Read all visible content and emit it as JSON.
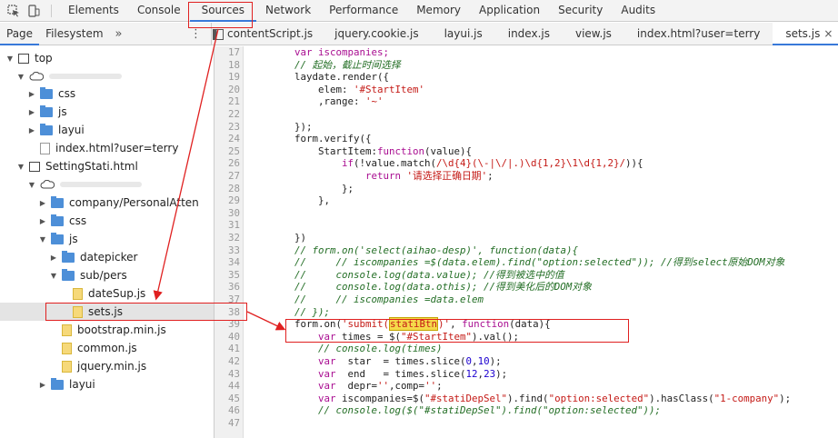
{
  "toolbar": {
    "tabs": [
      {
        "label": "Elements"
      },
      {
        "label": "Console"
      },
      {
        "label": "Sources"
      },
      {
        "label": "Network"
      },
      {
        "label": "Performance"
      },
      {
        "label": "Memory"
      },
      {
        "label": "Application"
      },
      {
        "label": "Security"
      },
      {
        "label": "Audits"
      }
    ],
    "active": "Sources"
  },
  "navigator": {
    "tabs": [
      {
        "label": "Page"
      },
      {
        "label": "Filesystem"
      }
    ],
    "more": "»",
    "menu": "⋮"
  },
  "editor_tabs": [
    {
      "label": "contentScript.js"
    },
    {
      "label": "jquery.cookie.js"
    },
    {
      "label": "layui.js"
    },
    {
      "label": "index.js"
    },
    {
      "label": "view.js"
    },
    {
      "label": "index.html?user=terry"
    },
    {
      "label": "sets.js",
      "close": "×"
    }
  ],
  "tree": [
    {
      "label": "top",
      "type": "frame",
      "expanded": true
    },
    {
      "label": "",
      "type": "domain",
      "expanded": true
    },
    {
      "label": "css",
      "type": "folder",
      "expanded": false
    },
    {
      "label": "js",
      "type": "folder",
      "expanded": false
    },
    {
      "label": "layui",
      "type": "folder",
      "expanded": false
    },
    {
      "label": "index.html?user=terry",
      "type": "file"
    },
    {
      "label": "SettingStati.html",
      "type": "frame",
      "expanded": true
    },
    {
      "label": "",
      "type": "domain",
      "expanded": true
    },
    {
      "label": "company/PersonalAtten",
      "type": "folder",
      "expanded": false
    },
    {
      "label": "css",
      "type": "folder",
      "expanded": false
    },
    {
      "label": "js",
      "type": "folder",
      "expanded": true
    },
    {
      "label": "datepicker",
      "type": "folder",
      "expanded": false
    },
    {
      "label": "sub/pers",
      "type": "folder",
      "expanded": true
    },
    {
      "label": "dateSup.js",
      "type": "jsfile"
    },
    {
      "label": "sets.js",
      "type": "jsfile",
      "selected": true
    },
    {
      "label": "bootstrap.min.js",
      "type": "jsfile"
    },
    {
      "label": "common.js",
      "type": "jsfile"
    },
    {
      "label": "jquery.min.js",
      "type": "jsfile"
    },
    {
      "label": "layui",
      "type": "folder",
      "expanded": false
    }
  ],
  "code": {
    "line_numbers": [
      "17",
      "18",
      "19",
      "20",
      "21",
      "22",
      "23",
      "24",
      "25",
      "26",
      "27",
      "28",
      "29",
      "30",
      "31",
      "32",
      "33",
      "34",
      "35",
      "36",
      "37",
      "38",
      "39",
      "40",
      "41",
      "42",
      "43",
      "44",
      "45",
      "46",
      "47"
    ],
    "l17": "var iscompanies;",
    "l18": "// 起始，截止时间选择",
    "l19": "laydate.render({",
    "l20a": "elem: ",
    "l20b": "'#StartItem'",
    "l21a": ",range: ",
    "l21b": "'~'",
    "l22": "",
    "l23": "});",
    "l24": "form.verify({",
    "l25a": "StartItem:",
    "l25b": "function",
    "l25c": "(value){",
    "l26a": "if",
    "l26b": "(!value.match(",
    "l26c": "/\\d{4}(\\-|\\/|.)\\d{1,2}\\1\\d{1,2}/",
    "l26d": ")){",
    "l27a": "return ",
    "l27b": "'请选择正确日期'",
    "l27c": ";",
    "l28": "};",
    "l29": "},",
    "l30": "",
    "l31": "",
    "l32": "})",
    "l33": "// form.on('select(aihao-desp)', function(data){",
    "l34": "//     // iscompanies =$(data.elem).find(\"option:selected\")); //得到select原始DOM对象",
    "l35": "//     console.log(data.value); //得到被选中的值",
    "l36": "//     console.log(data.othis); //得到美化后的DOM对象",
    "l37": "//     // iscompanies =data.elem",
    "l38": "// });",
    "l39a": "form.on(",
    "l39b": "'submit(",
    "l39c": "statiBtn",
    "l39d": ")'",
    "l39e": ", ",
    "l39f": "function",
    "l39g": "(data){",
    "l40a": "var ",
    "l40b": "times = $(",
    "l40c": "\"#StartItem\"",
    "l40d": ").val();",
    "l41": "// console.log(times)",
    "l42a": "var ",
    "l42b": " star  = times.slice(",
    "l42c": "0",
    "l42d": ",",
    "l42e": "10",
    "l42f": ");",
    "l43a": "var ",
    "l43b": " end   = times.slice(",
    "l43c": "12",
    "l43d": ",",
    "l43e": "23",
    "l43f": ");",
    "l44a": "var ",
    "l44b": " depr=",
    "l44c": "''",
    "l44d": ",comp=",
    "l44e": "''",
    "l44f": ";",
    "l45a": "var ",
    "l45b": "iscompanies=$(",
    "l45c": "\"#statiDepSel\"",
    "l45d": ").find(",
    "l45e": "\"option:selected\"",
    "l45f": ").hasClass(",
    "l45g": "\"1-company\"",
    "l45h": ");",
    "l46": "// console.log($(\"#statiDepSel\").find(\"option:selected\"));",
    "l47": ""
  },
  "colors": {
    "annotation": "#e02020",
    "accent": "#3879d9",
    "highlight": "#f5d94a"
  }
}
